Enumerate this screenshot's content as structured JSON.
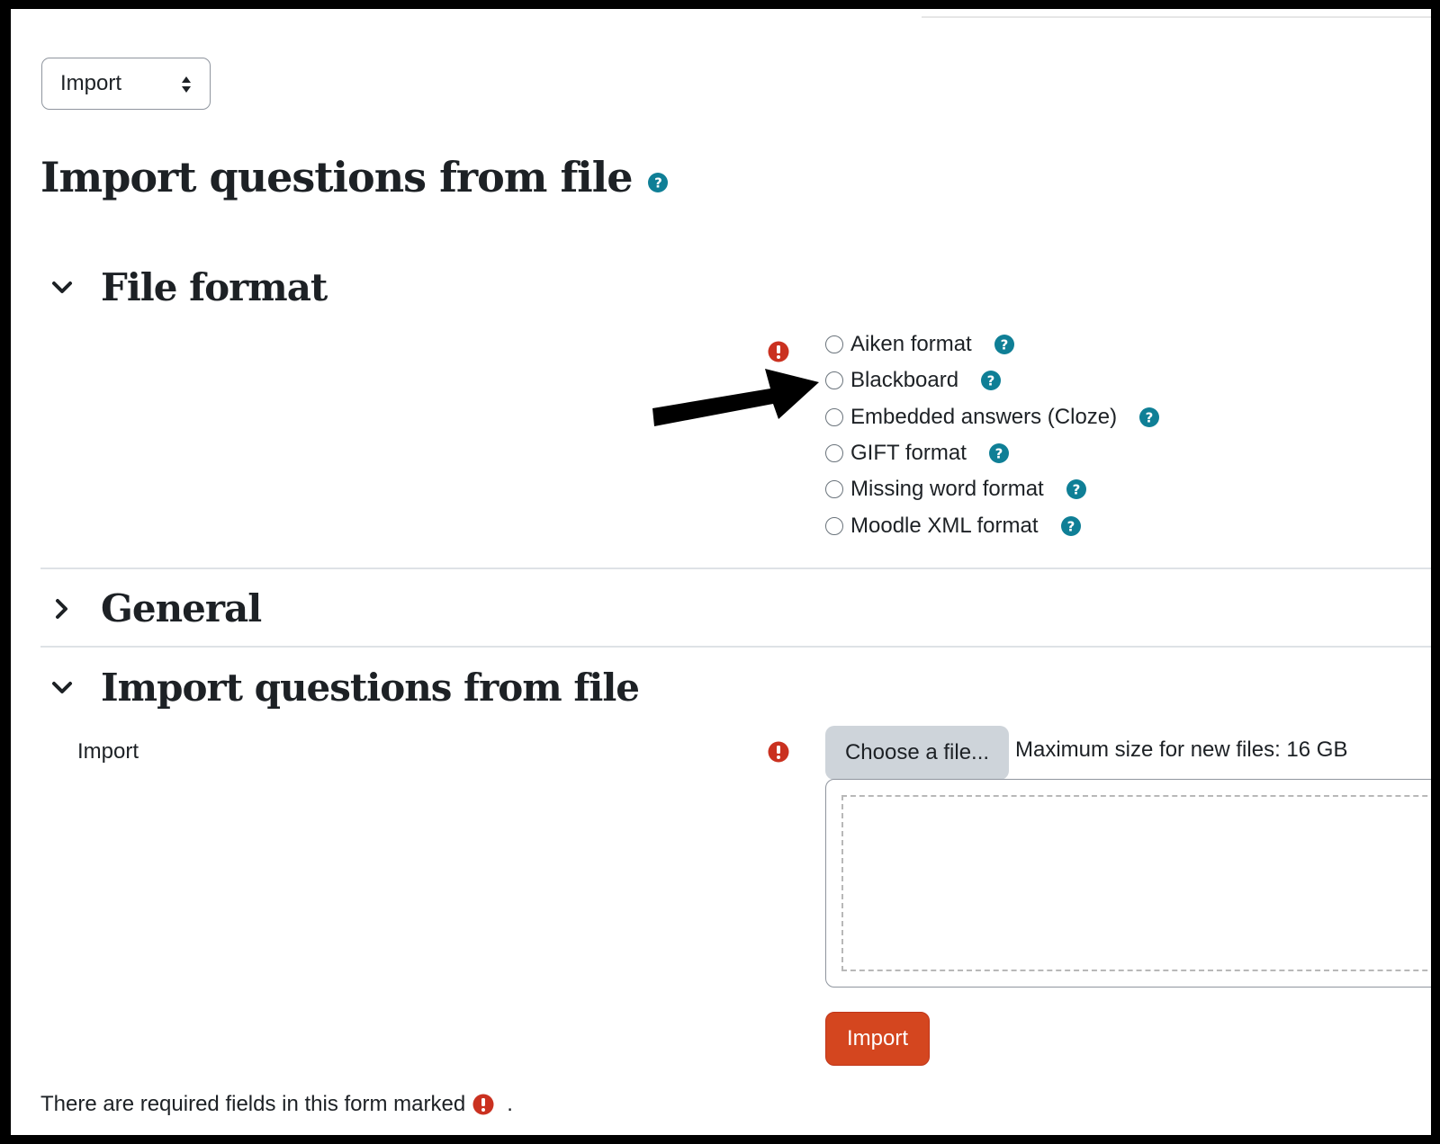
{
  "action_select": {
    "value": "Import"
  },
  "page": {
    "title": "Import questions from file"
  },
  "sections": {
    "file_format": {
      "title": "File format",
      "expanded": true,
      "options": [
        {
          "label": "Aiken format",
          "selected": false
        },
        {
          "label": "Blackboard",
          "selected": false
        },
        {
          "label": "Embedded answers (Cloze)",
          "selected": false
        },
        {
          "label": "GIFT format",
          "selected": false
        },
        {
          "label": "Missing word format",
          "selected": false
        },
        {
          "label": "Moodle XML format",
          "selected": false
        }
      ]
    },
    "general": {
      "title": "General",
      "expanded": false
    },
    "import_file": {
      "title": "Import questions from file",
      "expanded": true,
      "field_label": "Import",
      "choose_button": "Choose a file...",
      "max_size": "Maximum size for new files: 16 GB"
    }
  },
  "buttons": {
    "import": "Import"
  },
  "footer": {
    "required_note": "There are required fields in this form marked",
    "required_note_end": "."
  },
  "colors": {
    "help": "#0f6cbf",
    "help_teal": "#0f7f96",
    "required": "#ca3120",
    "primary": "#d4461f"
  }
}
